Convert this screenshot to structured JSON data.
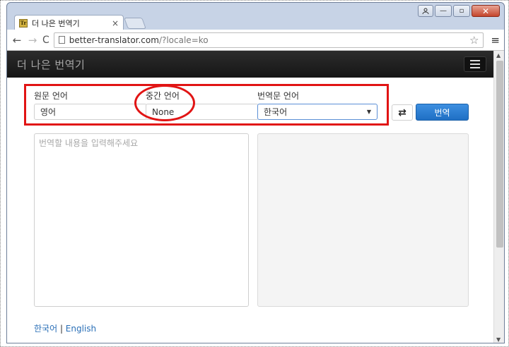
{
  "browser": {
    "tab_title": "더 나은 번역기",
    "tab_close": "×",
    "favicon_text": "Tr",
    "url_host": "better-translator.com",
    "url_path": "/?locale=ko",
    "win_minimize": "—",
    "win_maximize": "▫",
    "win_close": "✕"
  },
  "app": {
    "brand": "더 나은 번역기"
  },
  "form": {
    "source_label": "원문 언어",
    "source_value": "영어",
    "middle_label": "중간 언어",
    "middle_value": "None",
    "target_label": "번역문 언어",
    "target_value": "한국어",
    "swap_symbol": "⇄",
    "translate_label": "번역",
    "input_placeholder": "번역할 내용을 입력해주세요"
  },
  "footer": {
    "lang_ko": "한국어",
    "separator": " | ",
    "lang_en": "English"
  },
  "colors": {
    "navbar": "#1e1e1e",
    "primary_button": "#2a7ad4",
    "annotation": "#e11414",
    "link": "#2a6fb7"
  }
}
